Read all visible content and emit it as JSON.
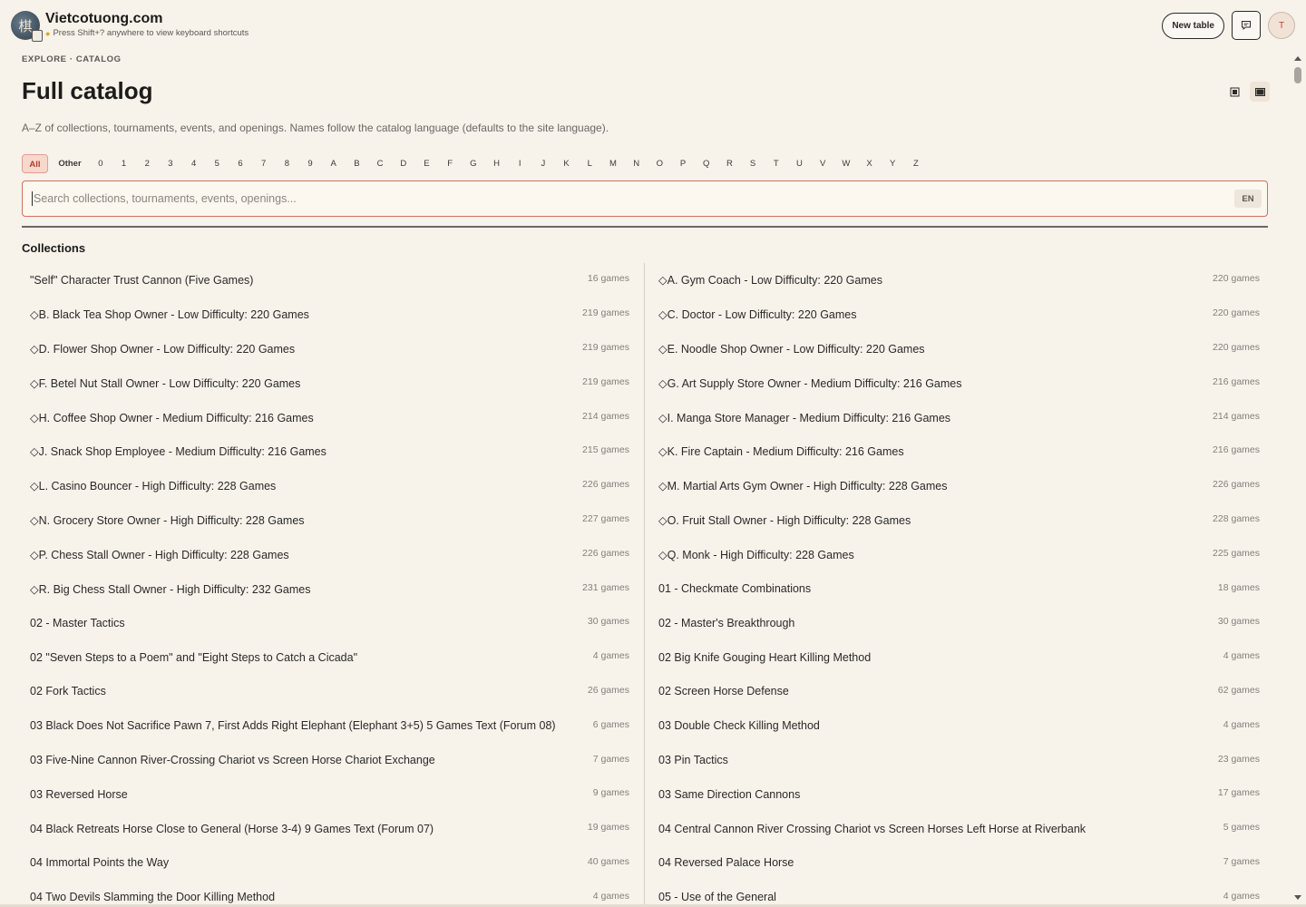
{
  "header": {
    "brand": "Vietcotuong.com",
    "logo_glyph": "棋",
    "hint": "Press Shift+? anywhere to view keyboard shortcuts",
    "new_table": "New table",
    "avatar_initial": "T"
  },
  "breadcrumb": "EXPLORE · CATALOG",
  "page_title": "Full catalog",
  "subtitle": "A–Z of collections, tournaments, events, and openings. Names follow the catalog language (defaults to the site language).",
  "letters": [
    "All",
    "Other",
    "0",
    "1",
    "2",
    "3",
    "4",
    "5",
    "6",
    "7",
    "8",
    "9",
    "A",
    "B",
    "C",
    "D",
    "E",
    "F",
    "G",
    "H",
    "I",
    "J",
    "K",
    "L",
    "M",
    "N",
    "O",
    "P",
    "Q",
    "R",
    "S",
    "T",
    "U",
    "V",
    "W",
    "X",
    "Y",
    "Z"
  ],
  "search": {
    "placeholder": "Search collections, tournaments, events, openings...",
    "value": "",
    "lang": "EN"
  },
  "section_title": "Collections",
  "left_items": [
    {
      "name": "\"Self\" Character Trust Cannon (Five Games)",
      "count": "16 games"
    },
    {
      "name": "◇B. Black Tea Shop Owner - Low Difficulty: 220 Games",
      "count": "219 games"
    },
    {
      "name": "◇D. Flower Shop Owner - Low Difficulty: 220 Games",
      "count": "219 games"
    },
    {
      "name": "◇F. Betel Nut Stall Owner - Low Difficulty: 220 Games",
      "count": "219 games"
    },
    {
      "name": "◇H. Coffee Shop Owner - Medium Difficulty: 216 Games",
      "count": "214 games"
    },
    {
      "name": "◇J. Snack Shop Employee - Medium Difficulty: 216 Games",
      "count": "215 games"
    },
    {
      "name": "◇L. Casino Bouncer - High Difficulty: 228 Games",
      "count": "226 games"
    },
    {
      "name": "◇N. Grocery Store Owner - High Difficulty: 228 Games",
      "count": "227 games"
    },
    {
      "name": "◇P. Chess Stall Owner - High Difficulty: 228 Games",
      "count": "226 games"
    },
    {
      "name": "◇R. Big Chess Stall Owner - High Difficulty: 232 Games",
      "count": "231 games"
    },
    {
      "name": "02 - Master Tactics",
      "count": "30 games"
    },
    {
      "name": "02 \"Seven Steps to a Poem\" and \"Eight Steps to Catch a Cicada\"",
      "count": "4 games"
    },
    {
      "name": "02 Fork Tactics",
      "count": "26 games"
    },
    {
      "name": "03 Black Does Not Sacrifice Pawn 7, First Adds Right Elephant (Elephant 3+5) 5 Games Text (Forum 08)",
      "count": "6 games"
    },
    {
      "name": "03 Five-Nine Cannon River-Crossing Chariot vs Screen Horse Chariot Exchange",
      "count": "7 games"
    },
    {
      "name": "03 Reversed Horse",
      "count": "9 games"
    },
    {
      "name": "04 Black Retreats Horse Close to General (Horse 3-4) 9 Games Text (Forum 07)",
      "count": "19 games"
    },
    {
      "name": "04 Immortal Points the Way",
      "count": "40 games"
    },
    {
      "name": "04 Two Devils Slamming the Door Killing Method",
      "count": "4 games"
    }
  ],
  "right_items": [
    {
      "name": "◇A. Gym Coach - Low Difficulty: 220 Games",
      "count": "220 games"
    },
    {
      "name": "◇C. Doctor - Low Difficulty: 220 Games",
      "count": "220 games"
    },
    {
      "name": "◇E. Noodle Shop Owner - Low Difficulty: 220 Games",
      "count": "220 games"
    },
    {
      "name": "◇G. Art Supply Store Owner - Medium Difficulty: 216 Games",
      "count": "216 games"
    },
    {
      "name": "◇I. Manga Store Manager - Medium Difficulty: 216 Games",
      "count": "214 games"
    },
    {
      "name": "◇K. Fire Captain - Medium Difficulty: 216 Games",
      "count": "216 games"
    },
    {
      "name": "◇M. Martial Arts Gym Owner - High Difficulty: 228 Games",
      "count": "226 games"
    },
    {
      "name": "◇O. Fruit Stall Owner - High Difficulty: 228 Games",
      "count": "228 games"
    },
    {
      "name": "◇Q. Monk - High Difficulty: 228 Games",
      "count": "225 games"
    },
    {
      "name": "01 - Checkmate Combinations",
      "count": "18 games"
    },
    {
      "name": "02 - Master's Breakthrough",
      "count": "30 games"
    },
    {
      "name": "02 Big Knife Gouging Heart Killing Method",
      "count": "4 games"
    },
    {
      "name": "02 Screen Horse Defense",
      "count": "62 games"
    },
    {
      "name": "03 Double Check Killing Method",
      "count": "4 games"
    },
    {
      "name": "03 Pin Tactics",
      "count": "23 games"
    },
    {
      "name": "03 Same Direction Cannons",
      "count": "17 games"
    },
    {
      "name": "04 Central Cannon River Crossing Chariot vs Screen Horses Left Horse at Riverbank",
      "count": "5 games"
    },
    {
      "name": "04 Reversed Palace Horse",
      "count": "7 games"
    },
    {
      "name": "05 - Use of the General",
      "count": "4 games"
    }
  ],
  "colors": {
    "background": "#f7f2ea",
    "accent": "#d2715c",
    "active_letter": "#b13d20"
  }
}
